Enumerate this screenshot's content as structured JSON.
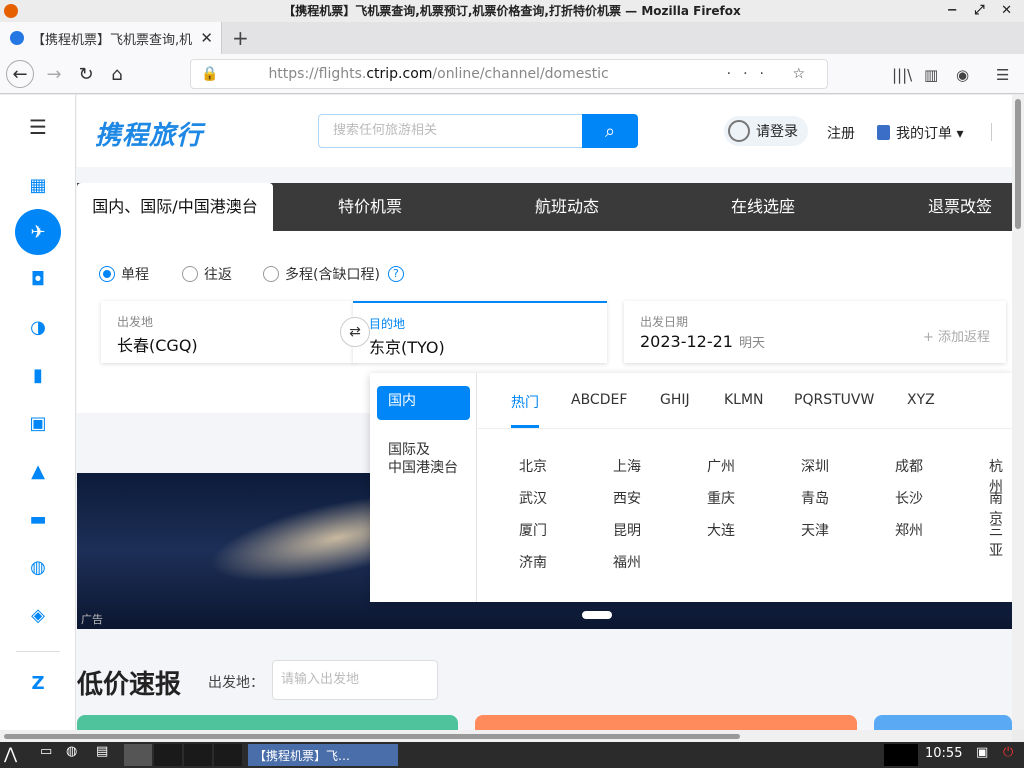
{
  "window": {
    "title": "【携程机票】飞机票查询,机票预订,机票价格查询,打折特价机票 — Mozilla Firefox"
  },
  "browser": {
    "tab_title": "【携程机票】飞机票查询,机票预订",
    "url_prefix": "https://flights.",
    "url_domain": "ctrip.com",
    "url_path": "/online/channel/domestic"
  },
  "header": {
    "logo": "携程旅行",
    "search_placeholder": "搜索任何旅游相关",
    "login": "请登录",
    "register": "注册",
    "orders": "我的订单"
  },
  "tabs": [
    "国内、国际/中国港澳台",
    "特价机票",
    "航班动态",
    "在线选座",
    "退票改签"
  ],
  "trip_types": {
    "oneway": "单程",
    "round": "往返",
    "multi": "多程(含缺口程)",
    "help": "?"
  },
  "search_form": {
    "from_label": "出发地",
    "from_value": "长春(CGQ)",
    "to_label": "目的地",
    "to_value": "东京(TYO)",
    "date_label": "出发日期",
    "date_value": "2023-12-21",
    "date_sub": "明天",
    "add_return": "+ 添加返程"
  },
  "city_popup": {
    "region_tabs": [
      "国内",
      "国际及\n中国港澳台"
    ],
    "letter_tabs": [
      "热门",
      "ABCDEF",
      "GHIJ",
      "KLMN",
      "PQRSTUVW",
      "XYZ"
    ],
    "cities": [
      "北京",
      "上海",
      "广州",
      "深圳",
      "成都",
      "杭州",
      "武汉",
      "西安",
      "重庆",
      "青岛",
      "长沙",
      "南京",
      "厦门",
      "昆明",
      "大连",
      "天津",
      "郑州",
      "三亚",
      "济南",
      "福州"
    ]
  },
  "banner": {
    "ad_label": "广告"
  },
  "low_price": {
    "title": "低价速报",
    "from_label": "出发地：",
    "from_placeholder": "请输入出发地"
  },
  "taskbar": {
    "app": "【携程机票】飞…",
    "clock": "10:55"
  },
  "colors": {
    "accent": "#0086f6",
    "tab_bar": "#3a3a3a"
  }
}
